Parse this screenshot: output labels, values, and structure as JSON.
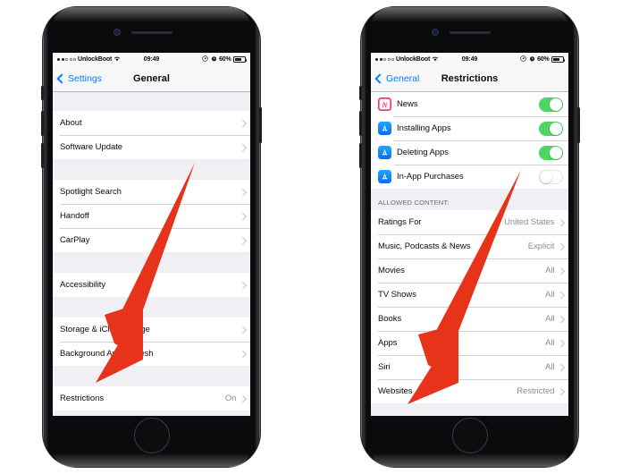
{
  "accent": {
    "ios_blue": "#0b7bff",
    "toggle_green": "#4cd764",
    "arrow_red": "#e8331b",
    "news_red": "#fb2e53",
    "appstore_blue": "#0a6cf5",
    "list_bg": "#efeff4",
    "value_gray": "#8d8d93"
  },
  "status_bar": {
    "carrier": "UnlockBoot",
    "time": "09:49",
    "battery_pct": "60%",
    "signal_filled_dots": 2,
    "signal_hollow_dots": 3,
    "icons": [
      "wifi-icon",
      "location-arrow-icon",
      "alarm-icon",
      "battery-icon"
    ]
  },
  "left_phone": {
    "nav": {
      "back_label": "Settings",
      "title": "General",
      "back_icon": "chevron-left-icon"
    },
    "groups": [
      {
        "rows": [
          {
            "label": "About",
            "value": "",
            "chevron": true
          },
          {
            "label": "Software Update",
            "value": "",
            "chevron": true
          }
        ]
      },
      {
        "rows": [
          {
            "label": "Spotlight Search",
            "value": "",
            "chevron": true
          },
          {
            "label": "Handoff",
            "value": "",
            "chevron": true
          },
          {
            "label": "CarPlay",
            "value": "",
            "chevron": true
          }
        ]
      },
      {
        "rows": [
          {
            "label": "Accessibility",
            "value": "",
            "chevron": true
          }
        ]
      },
      {
        "rows": [
          {
            "label": "Storage & iCloud Usage",
            "value": "",
            "chevron": true
          },
          {
            "label": "Background App Refresh",
            "value": "",
            "chevron": true
          }
        ]
      },
      {
        "rows": [
          {
            "label": "Restrictions",
            "value": "On",
            "chevron": true
          }
        ]
      }
    ]
  },
  "right_phone": {
    "nav": {
      "back_label": "General",
      "title": "Restrictions",
      "back_icon": "chevron-left-icon"
    },
    "toggle_rows": [
      {
        "label": "News",
        "icon": "news-app-icon",
        "icon_type": "news",
        "state": "on"
      },
      {
        "label": "Installing Apps",
        "icon": "app-store-icon",
        "icon_type": "appstore",
        "state": "on"
      },
      {
        "label": "Deleting Apps",
        "icon": "app-store-icon",
        "icon_type": "appstore",
        "state": "on"
      },
      {
        "label": "In-App Purchases",
        "icon": "app-store-icon",
        "icon_type": "appstore",
        "state": "off"
      }
    ],
    "section_header": "ALLOWED CONTENT:",
    "content_rows": [
      {
        "label": "Ratings For",
        "value": "United States"
      },
      {
        "label": "Music, Podcasts & News",
        "value": "Explicit"
      },
      {
        "label": "Movies",
        "value": "All"
      },
      {
        "label": "TV Shows",
        "value": "All"
      },
      {
        "label": "Books",
        "value": "All"
      },
      {
        "label": "Apps",
        "value": "All"
      },
      {
        "label": "Siri",
        "value": "All"
      },
      {
        "label": "Websites",
        "value": "Restricted"
      }
    ]
  },
  "annotations": {
    "left_arrow_target": "Restrictions",
    "right_arrow_target": "Websites"
  }
}
